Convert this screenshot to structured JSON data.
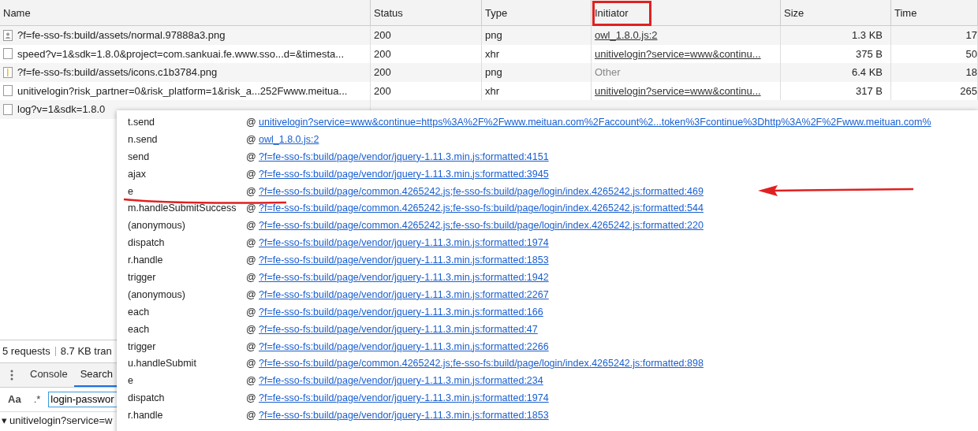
{
  "table": {
    "columns": [
      "Name",
      "Status",
      "Type",
      "Initiator",
      "Size",
      "Time"
    ],
    "rows": [
      {
        "kind": "image",
        "name": "?f=fe-sso-fs:build/assets/normal.97888a3.png",
        "status": "200",
        "type": "png",
        "initiator": "owl_1.8.0.js:2",
        "initiator_link": true,
        "size": "1.3 KB",
        "time": "17"
      },
      {
        "kind": "doc",
        "name": "speed?v=1&sdk=1.8.0&project=com.sankuai.fe.www.sso...d=&timesta...",
        "status": "200",
        "type": "xhr",
        "initiator": "unitivelogin?service=www&continu...",
        "initiator_link": true,
        "size": "375 B",
        "time": "50"
      },
      {
        "kind": "sprite",
        "name": "?f=fe-sso-fs:build/assets/icons.c1b3784.png",
        "status": "200",
        "type": "png",
        "initiator": "Other",
        "initiator_link": false,
        "size": "6.4 KB",
        "time": "18"
      },
      {
        "kind": "doc",
        "name": "unitivelogin?risk_partner=0&risk_platform=1&risk_a...252Fwww.meitua...",
        "status": "200",
        "type": "xhr",
        "initiator": "unitivelogin?service=www&continu...",
        "initiator_link": true,
        "size": "317 B",
        "time": "265"
      },
      {
        "kind": "doc",
        "name": "log?v=1&sdk=1.8.0"
      }
    ]
  },
  "summary": {
    "requests": "5 requests",
    "transferred": "8.7 KB tran"
  },
  "drawer": {
    "tabs": [
      {
        "label": "Console",
        "selected": false
      },
      {
        "label": "Search",
        "selected": true
      }
    ]
  },
  "search": {
    "case_toggle": "Aa",
    "regex_toggle": ".*",
    "value": "login-passwor"
  },
  "result": {
    "arrow": "▾",
    "text": "unitivelogin?service=w"
  },
  "call_stack": [
    {
      "fn": "t.send",
      "src": "unitivelogin?service=www&continue=https%3A%2F%2Fwww.meituan.com%2Faccount%2...token%3Fcontinue%3Dhttp%3A%2F%2Fwww.meituan.com%"
    },
    {
      "fn": "n.send",
      "src": "owl_1.8.0.js:2"
    },
    {
      "fn": "send",
      "src": "?f=fe-sso-fs:build/page/vendor/jquery-1.11.3.min.js:formatted:4151"
    },
    {
      "fn": "ajax",
      "src": "?f=fe-sso-fs:build/page/vendor/jquery-1.11.3.min.js:formatted:3945"
    },
    {
      "fn": "e",
      "src": "?f=fe-sso-fs:build/page/common.4265242.js;fe-sso-fs:build/page/login/index.4265242.js:formatted:469"
    },
    {
      "fn": "m.handleSubmitSuccess",
      "src": "?f=fe-sso-fs:build/page/common.4265242.js;fe-sso-fs:build/page/login/index.4265242.js:formatted:544"
    },
    {
      "fn": "(anonymous)",
      "src": "?f=fe-sso-fs:build/page/common.4265242.js;fe-sso-fs:build/page/login/index.4265242.js:formatted:220"
    },
    {
      "fn": "dispatch",
      "src": "?f=fe-sso-fs:build/page/vendor/jquery-1.11.3.min.js:formatted:1974"
    },
    {
      "fn": "r.handle",
      "src": "?f=fe-sso-fs:build/page/vendor/jquery-1.11.3.min.js:formatted:1853"
    },
    {
      "fn": "trigger",
      "src": "?f=fe-sso-fs:build/page/vendor/jquery-1.11.3.min.js:formatted:1942"
    },
    {
      "fn": "(anonymous)",
      "src": "?f=fe-sso-fs:build/page/vendor/jquery-1.11.3.min.js:formatted:2267"
    },
    {
      "fn": "each",
      "src": "?f=fe-sso-fs:build/page/vendor/jquery-1.11.3.min.js:formatted:166"
    },
    {
      "fn": "each",
      "src": "?f=fe-sso-fs:build/page/vendor/jquery-1.11.3.min.js:formatted:47"
    },
    {
      "fn": "trigger",
      "src": "?f=fe-sso-fs:build/page/vendor/jquery-1.11.3.min.js:formatted:2266"
    },
    {
      "fn": "u.handleSubmit",
      "src": "?f=fe-sso-fs:build/page/common.4265242.js;fe-sso-fs:build/page/login/index.4265242.js:formatted:898"
    },
    {
      "fn": "e",
      "src": "?f=fe-sso-fs:build/page/vendor/jquery-1.11.3.min.js:formatted:234"
    },
    {
      "fn": "dispatch",
      "src": "?f=fe-sso-fs:build/page/vendor/jquery-1.11.3.min.js:formatted:1974"
    },
    {
      "fn": "r.handle",
      "src": "?f=fe-sso-fs:build/page/vendor/jquery-1.11.3.min.js:formatted:1853"
    }
  ],
  "at_sign": "@"
}
